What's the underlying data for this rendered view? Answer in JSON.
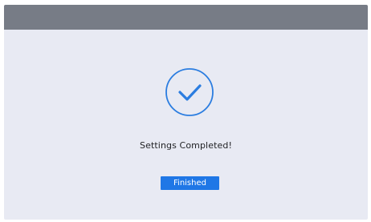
{
  "dialog": {
    "message": "Settings Completed!",
    "finished_label": "Finished"
  },
  "icons": {
    "status": "checkmark-circle-icon"
  },
  "colors": {
    "top_bar": "#777c86",
    "background": "#e8eaf3",
    "accent": "#1f77e6",
    "text": "#1f2023"
  }
}
